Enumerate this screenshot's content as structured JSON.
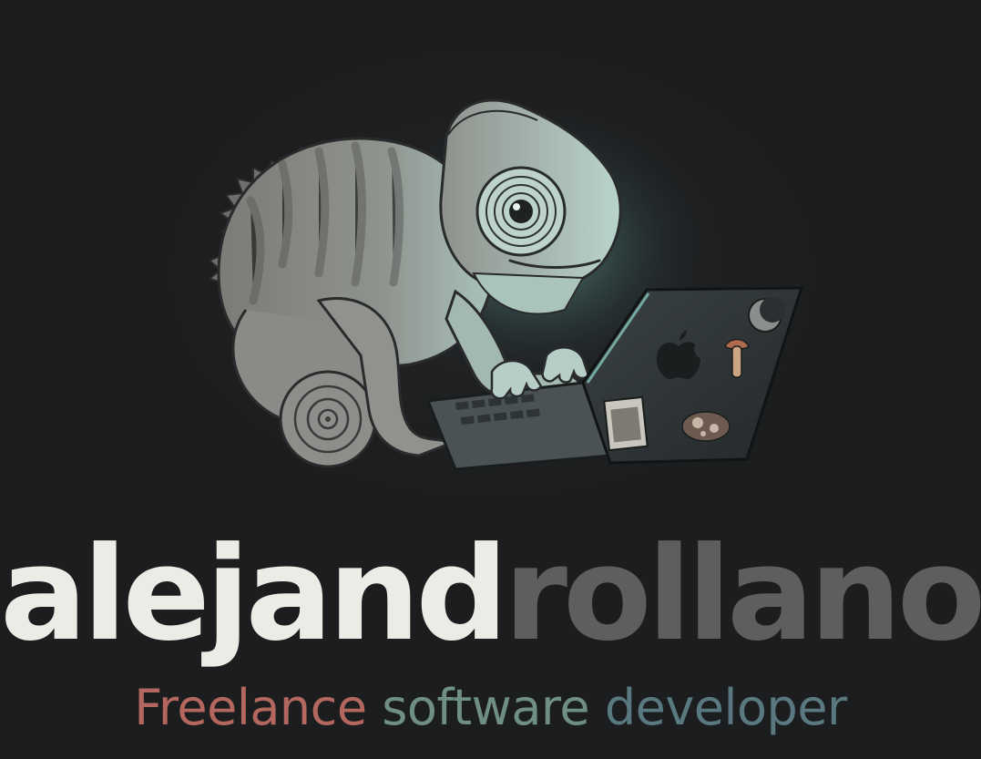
{
  "brand": {
    "name_first": "alejand",
    "name_last": "rollano",
    "tagline_word1": "Freelance",
    "tagline_word2": "software",
    "tagline_word3": "developer"
  },
  "colors": {
    "background": "#1c1d1f",
    "name_first": "#ecebe6",
    "name_last": "#5c5e5f",
    "tagline_word1": "#b3675e",
    "tagline_word2": "#6f8f83",
    "tagline_word3": "#597880",
    "glow": "#9fe0d8"
  },
  "illustration": {
    "subject": "chameleon-using-laptop",
    "stickers": [
      "crescent-moon-sticker",
      "mushroom-sticker",
      "fungus-sticker",
      "comic-sticker"
    ]
  }
}
